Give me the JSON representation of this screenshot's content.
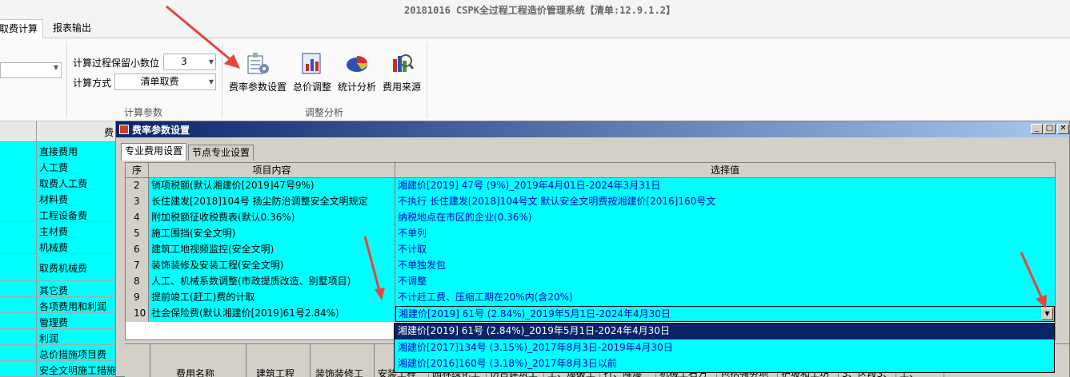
{
  "window": {
    "title": "20181016     CSPK全过程工程造价管理系统【清单:12.9.1.2】"
  },
  "ribbon_tabs": [
    {
      "label": "取费计算"
    },
    {
      "label": "报表输出"
    }
  ],
  "calc_params": {
    "decimal_label": "计算过程保留小数位",
    "decimal_value": "3",
    "method_label": "计算方式",
    "method_value": "清单取费",
    "group_label": "计算参数"
  },
  "adjust_group": {
    "group_label": "调整分析",
    "tools": [
      {
        "label": "费率参数设置",
        "icon": "rate-settings-icon"
      },
      {
        "label": "总价调整",
        "icon": "total-adjust-icon"
      },
      {
        "label": "统计分析",
        "icon": "pie-chart-icon"
      },
      {
        "label": "费用来源",
        "icon": "fee-source-icon"
      }
    ]
  },
  "left_panel": {
    "header": "费",
    "items": [
      {
        "label": "直接费用"
      },
      {
        "label": "人工费"
      },
      {
        "label": "取费人工费"
      },
      {
        "label": "材料费"
      },
      {
        "label": "工程设备费"
      },
      {
        "label": "主材费"
      },
      {
        "label": "机械费"
      },
      {
        "label": "取费机械费"
      },
      {
        "label": "其它费"
      },
      {
        "label": "各项费用和利润"
      },
      {
        "label": "管理费"
      },
      {
        "label": "利润"
      },
      {
        "label": "总价措施项目费"
      },
      {
        "label": "安全文明施工措施"
      }
    ]
  },
  "dialog": {
    "title": "费率参数设置",
    "tabs": [
      {
        "label": "专业费用设置"
      },
      {
        "label": "节点专业设置"
      }
    ],
    "columns": {
      "seq": "序",
      "item": "项目内容",
      "value": "选择值"
    },
    "rows": [
      {
        "seq": "2",
        "item": "销项税额(默认湘建价[2019]47号9%)",
        "value": "湘建价[2019] 47号 (9%)_2019年4月01日-2024年3月31日"
      },
      {
        "seq": "3",
        "item": "长住建发[2018]104号 扬尘防治调整安全文明规定",
        "value": "不执行 长住建发[2018]104号文 默认安全文明费按湘建价[2016]160号文"
      },
      {
        "seq": "4",
        "item": "附加税额征收税费表(默认0.36%)",
        "value": "纳税地点在市区的企业(0.36%)"
      },
      {
        "seq": "5",
        "item": "施工围挡(安全文明)",
        "value": "不单列"
      },
      {
        "seq": "6",
        "item": "建筑工地视频监控(安全文明)",
        "value": "不计取"
      },
      {
        "seq": "7",
        "item": "装饰装修及安装工程(安全文明)",
        "value": "不单独发包"
      },
      {
        "seq": "8",
        "item": "人工、机械系数调整(市政提质改造、别墅项目)",
        "value": "不调整"
      },
      {
        "seq": "9",
        "item": "提前竣工(赶工)费的计取",
        "value": "不计赶工费、压缩工期在20%内(含20%)"
      },
      {
        "seq": "10",
        "item": "社会保险费(默认湘建价[2019]61号2.84%)",
        "value": "湘建价[2019] 61号 (2.84%)_2019年5月1日-2024年4月30日"
      }
    ],
    "dropdown_options": [
      "湘建价[2019] 61号 (2.84%)_2019年5月1日-2024年4月30日",
      "湘建价[2017]134号 (3.15%)_2017年8月3日-2019年4月30日",
      "湘建价[2016]160号 (3.18%)_2017年8月3日以前"
    ],
    "bottom_headers": [
      "费用名称",
      "建筑工程",
      "装饰装修工",
      "安装工程",
      "园林绿化工",
      "仿古建筑工",
      "土、爆破工",
      "打、降爆",
      "机械土石方",
      "包括强夯地",
      "护坡和土坊",
      "3、区段3、",
      "土、"
    ]
  },
  "colors": {
    "cyan": "#00ffff",
    "highlight": "#0a246a",
    "value_text": "#0000c0",
    "arrow": "#e8443a"
  }
}
